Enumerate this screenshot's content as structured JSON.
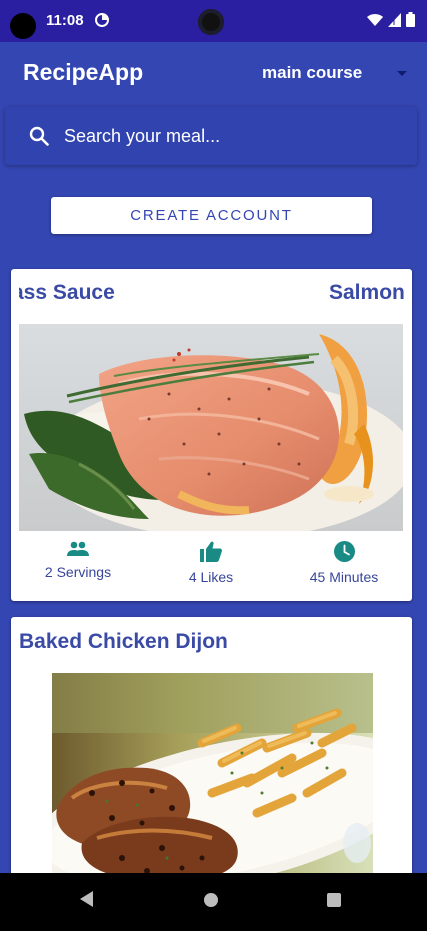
{
  "status_bar": {
    "time": "11:08"
  },
  "header": {
    "app_title": "RecipeApp",
    "category": "main course"
  },
  "search": {
    "placeholder": "Search your meal..."
  },
  "create_account": {
    "label": "CREATE ACCOUNT"
  },
  "recipes": [
    {
      "title_visible": "emongrass Sauce",
      "title_next": "Salmon",
      "servings": "2 Servings",
      "likes": "4 Likes",
      "minutes": "45 Minutes"
    },
    {
      "title": "Baked Chicken Dijon"
    }
  ],
  "icons": {
    "search": "search-icon",
    "servings": "people-icon",
    "likes": "thumb-up-icon",
    "minutes": "clock-icon",
    "dropdown": "caret-down-icon"
  },
  "colors": {
    "primary": "#3446b2",
    "status_bar": "#2a1fa0",
    "accent_teal": "#1a8a84",
    "title_text": "#3a4ba6"
  }
}
